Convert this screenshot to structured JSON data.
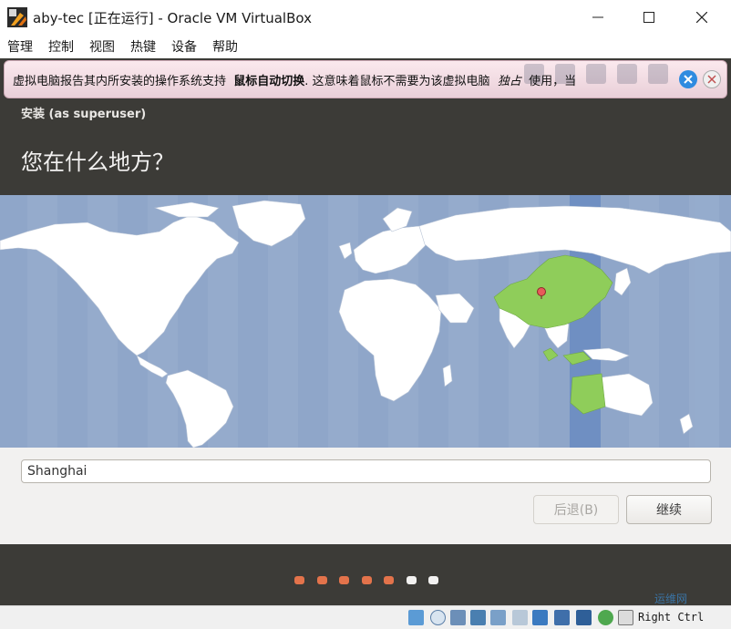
{
  "window": {
    "title": "aby-tec [正在运行] - Oracle VM VirtualBox"
  },
  "menu": [
    "管理",
    "控制",
    "视图",
    "热键",
    "设备",
    "帮助"
  ],
  "notification": {
    "text_before": "虚拟电脑报告其内所安装的操作系统支持",
    "text_bold": "鼠标自动切换",
    "text_middle": ". 这意味着鼠标不需要为该虚拟电脑",
    "text_italic": "独占",
    "text_after": "使用，当"
  },
  "installer": {
    "header": "安装 (as superuser)",
    "question": "您在什么地方？",
    "city_value": "Shanghai",
    "back_label": "后退(B)",
    "next_label": "继续",
    "progress": {
      "total": 7,
      "completed": 5
    }
  },
  "statusbar": {
    "host_key": "Right Ctrl"
  },
  "watermark": "运维网",
  "colors": {
    "ocean": "#8fa6c9",
    "land": "#ffffff",
    "selected_region": "#8fcd5a",
    "selected_timezone_band": "#6f8fc2",
    "dot_done": "#e3734b",
    "dot_todo": "#f2f1f0"
  }
}
